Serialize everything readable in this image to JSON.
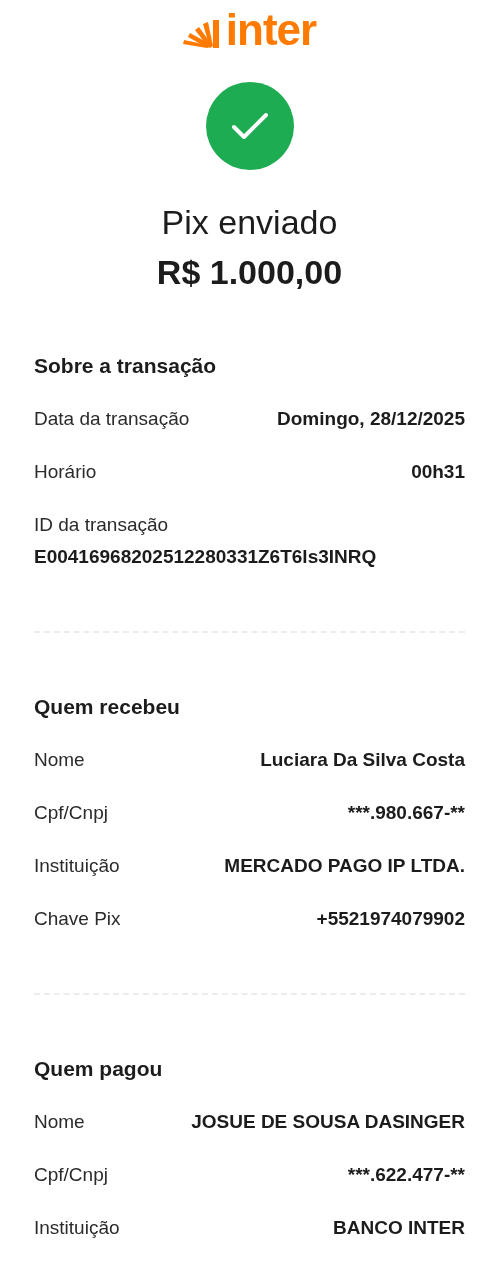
{
  "logo": {
    "text": "inter"
  },
  "status": {
    "title": "Pix enviado",
    "amount": "R$ 1.000,00"
  },
  "sections": [
    {
      "title": "Sobre a transação",
      "rows": [
        {
          "kind": "inline",
          "label": "Data da transação",
          "value": "Domingo, 28/12/2025"
        },
        {
          "kind": "inline",
          "label": "Horário",
          "value": "00h31"
        },
        {
          "kind": "stacked",
          "label": "ID da transação",
          "value": "E00416968202512280331Z6T6ls3INRQ"
        }
      ]
    },
    {
      "title": "Quem recebeu",
      "rows": [
        {
          "kind": "inline",
          "label": "Nome",
          "value": "Luciara Da Silva Costa"
        },
        {
          "kind": "inline",
          "label": "Cpf/Cnpj",
          "value": "***.980.667-**"
        },
        {
          "kind": "inline",
          "label": "Instituição",
          "value": "MERCADO PAGO IP LTDA."
        },
        {
          "kind": "inline",
          "label": "Chave Pix",
          "value": "+5521974079902"
        }
      ]
    },
    {
      "title": "Quem pagou",
      "rows": [
        {
          "kind": "inline",
          "label": "Nome",
          "value": "JOSUE DE SOUSA DASINGER"
        },
        {
          "kind": "inline",
          "label": "Cpf/Cnpj",
          "value": "***.622.477-**"
        },
        {
          "kind": "inline",
          "label": "Instituição",
          "value": "BANCO INTER"
        }
      ]
    }
  ]
}
